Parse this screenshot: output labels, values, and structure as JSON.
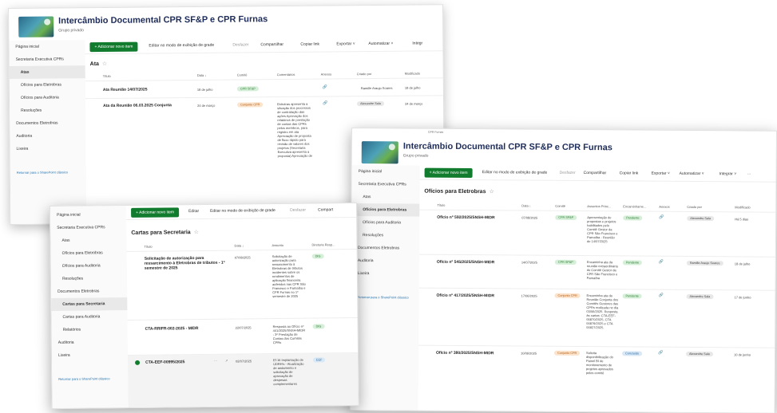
{
  "colors": {
    "accent": "#127c2e",
    "title": "#1f2d5a",
    "link": "#1a6fb0"
  },
  "win1": {
    "title": "Intercâmbio Documental CPR SF&P e CPR Furnas",
    "subtitle": "Grupo privado",
    "nav": [
      "Página inicial",
      "Secretaria Executiva CPRs",
      "Atas",
      "Ofícios para Eletrobras",
      "Ofícios para Auditoria",
      "Resoluções",
      "Documentos Eletrobras",
      "Auditoria",
      "Lixeira",
      "Retornar para o SharePoint clássico"
    ],
    "toolbar": [
      "+ Adicionar novo item",
      "Editar no modo de exibição de grade",
      "Desfazer",
      "Compartilhar",
      "Copiar link",
      "Exportar ˅",
      "Automatizar ˅",
      "Integr"
    ],
    "view_title": "Ata",
    "star": "☆",
    "columns": [
      "Título",
      "Data ↓",
      "Comitê",
      "Comentários",
      "Anexos",
      "Criado por",
      "Modificado"
    ],
    "rows": [
      {
        "title": "Ata Reunião 14/07/2025",
        "date": "18 de julho",
        "committee": "CPR SF&P",
        "comment": "",
        "author": "Ramille Araujo Soares",
        "modified": "18 de julho"
      },
      {
        "title": "Ata da Reunião 06.03.2025 Conjunta",
        "date": "24 de março",
        "committee": "Conjunto CPR",
        "comment": "Estrutras apresenta a situação dos processos de contratação das ações Aprovação dos relatórios de prestação de contas das CPRs pelos membros, para registro em ata Apreciação de proposta de fluxo rápido para revisão de valores dos projetos (Secretaria Executiva apresenta a proposta) Apreciação de",
        "author": "Alexandre Sala",
        "modified": "24 de março"
      }
    ]
  },
  "win2": {
    "nav": [
      "Página inicial",
      "Secretaria Executiva CPRs",
      "Atas",
      "Ofícios para Eletrobras",
      "Ofícios para Auditoria",
      "Resoluções",
      "Documentos Eletrobras",
      "Cartas para Secretaria",
      "Cartas para Auditoria",
      "Relatórios",
      "Auditoria",
      "Lixeira",
      "Retornar para o SharePoint clássico"
    ],
    "toolbar": [
      "+ Adicionar novo item",
      "Editar",
      "Editar no modo de exibição de grade",
      "Desfazer",
      "Compart"
    ],
    "view_title": "Cartas para Secretaria",
    "star": "☆",
    "columns": [
      "Título",
      "Data ↓",
      "Assunto",
      "Diretoria Resp..."
    ],
    "rows": [
      {
        "title": "Solicitação de autorização para ressarcimento à Eletrobras de tributos - 1º semestre de 2025",
        "date": "07/08/2025",
        "subject": "Solicitação de autorização para ressarcimento à Eletrobras de tributos incidentes sobre os rendimentos de aplicação financeira auferidos nas CPR São Francisco e Parnaíba e CPR Furnas no 1º semestre de 2025",
        "dir": "DIG"
      },
      {
        "title": "CTA-RRIFR-002-2025 - MIDR",
        "date": "22/07/2025",
        "subject": "Resposta ao Ofício nº 441/2025/SNSH-MIDR - 3ª Prestação de Contas dos Comitês CPRs",
        "dir": "DIG"
      },
      {
        "title": "CTA-EEF-00995/2025",
        "date": "02/07/2025",
        "subject": "Ef.16 Implantação de UDRH's - Atualização de andamento e solicitação de aprovação de despesas complementares",
        "dir": "EEF"
      }
    ]
  },
  "win3": {
    "tooltip": "CPR Furnas",
    "title": "Intercâmbio Documental CPR SF&P e CPR Furnas",
    "subtitle": "Grupo privado",
    "nav": [
      "Página inicial",
      "Secretaria Executiva CPRs",
      "Atas",
      "Ofícios para Eletrobras",
      "Ofícios para Auditoria",
      "Resoluções",
      "Documentos Eletrobras",
      "Auditoria",
      "Lixeira",
      "Retornar para o SharePoint clássico"
    ],
    "toolbar": [
      "+ Adicionar novo item",
      "Editar no modo de exibição de grade",
      "Desfazer",
      "Compartilhar",
      "Copiar link",
      "Exportar ˅",
      "Automatizar ˅",
      "Integrar ˅",
      "···"
    ],
    "view_title": "Ofícios para Eletrobras",
    "star": "☆",
    "columns": [
      "Título",
      "Data ↓",
      "Comitê",
      "Assuntos Princ...",
      "Encaminhame...",
      "Anexos",
      "Criado por",
      "Modificado"
    ],
    "rows": [
      {
        "title": "Ofício nº 592/2025/SNSH-MIDR",
        "date": "07/08/2025",
        "committee": "CPR SF&P",
        "subject": "Apresentação de propostas e projetos habilitados pelo Comitê Gestor da CPR São Francisco e Parnaíba - Reunião de 14/07/2025",
        "status": "Pendente",
        "author": "Alexandre Sala",
        "modified": "Há 5 dias"
      },
      {
        "title": "Ofício nº 545/2025/SNSH-MIDR",
        "date": "14/07/2025",
        "committee": "CPR SF&P",
        "subject": "Encaminha ata da reunião extraordinária do Comitê Gestor da CPR São Francisco e Parnaíba",
        "status": "Pendente",
        "author": "Ramille Araujo Soares",
        "modified": "18 de julho"
      },
      {
        "title": "Ofício nº 417/2025/SNSH-MIDR",
        "date": "17/06/2025",
        "committee": "Conjunto CPR",
        "subject": "Encaminha ata da Reunião Conjunta dos Comitês Gestores das CPRs realizada no dia 03/06/2025. Resposta às cartas: CTA-EEF-00870/2025, CTA 00879/2025 e CTA 00927/2025.",
        "status": "Pendente",
        "author": "Alexandre Sala",
        "modified": "17 de junho"
      },
      {
        "title": "Ofício nº 380/2025/SNSH-MIDR",
        "date": "10/06/2025",
        "committee": "Conjunto CPR",
        "subject": "Solicita disponibilização do Painel BI de monitoramento de projetos aprovados pelos comitê",
        "status": "Concluído",
        "author": "Alexandre Sala",
        "modified": "10 de junho"
      }
    ]
  }
}
